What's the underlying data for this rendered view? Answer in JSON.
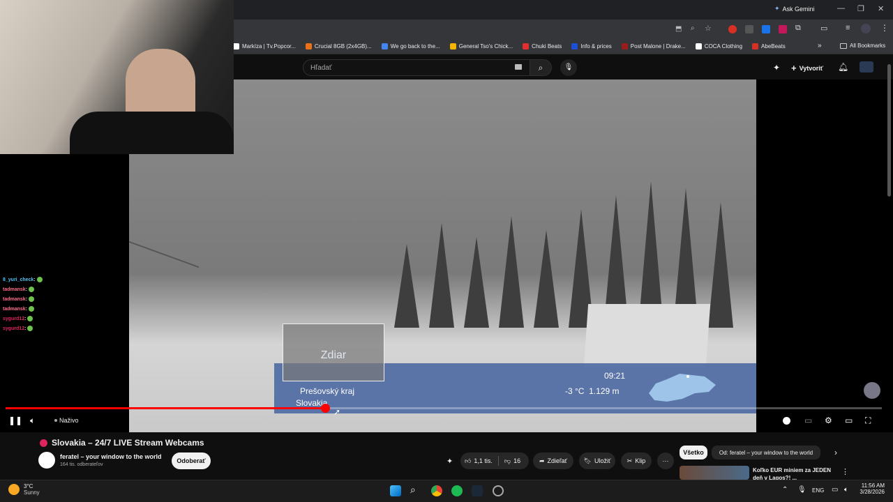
{
  "browser": {
    "ask_gemini": "Ask Gemini",
    "bookmarks": [
      {
        "label": "Markíza | Tv.Popcor...",
        "color": "#ffffff"
      },
      {
        "label": "Crucial 8GB (2x4GB)...",
        "color": "#e8711a"
      },
      {
        "label": "We go back to the...",
        "color": "#4285f4"
      },
      {
        "label": "General Tso's Chick...",
        "color": "#f4b400"
      },
      {
        "label": "Chuki Beats",
        "color": "#e02f2f"
      },
      {
        "label": "Info & prices",
        "color": "#1a4fd6"
      },
      {
        "label": "Post Malone | Drake...",
        "color": "#9b1c1c"
      },
      {
        "label": "COCA Clothing",
        "color": "#ffffff"
      },
      {
        "label": "AbeBeats",
        "color": "#d93025"
      }
    ],
    "all_bookmarks": "All Bookmarks",
    "more_chevron": "»"
  },
  "yt_header": {
    "search_placeholder": "Hľadať",
    "create_label": "Vytvoriť"
  },
  "overlay": {
    "cam_title": "Zdiar",
    "region": "Prešovský kraj",
    "country": "Slovakia",
    "time": "09:21",
    "weather": "-3 °C  1.129 m"
  },
  "chat": [
    {
      "user": "8_yuri_check",
      "color": "#4fc3f7"
    },
    {
      "user": "tadmansk",
      "color": "#ff6b8b"
    },
    {
      "user": "tadmansk",
      "color": "#ff6b8b"
    },
    {
      "user": "tadmansk",
      "color": "#ff6b8b"
    },
    {
      "user": "sygurd12",
      "color": "#e0245e"
    },
    {
      "user": "sygurd12",
      "color": "#e0245e"
    }
  ],
  "player": {
    "live_label": "Naživo",
    "progress_fraction": 0.365
  },
  "video_info": {
    "title": "Slovakia – 24/7 LIVE Stream Webcams",
    "channel_name": "feratel – your window to the world",
    "subscribers": "164 tis. odberateľov",
    "subscribe_label": "Odoberať",
    "likes": "1,1 tis.",
    "dislikes": "16",
    "share": "Zdieľať",
    "save": "Uložiť",
    "clip": "Klip",
    "chip_all": "Všetko",
    "chip_from": "Od: feratel – your window to the world",
    "rec_title": "Koľko EUR miniem za JEDEN",
    "rec_subtitle": "deň v Lagos?! ..."
  },
  "taskbar": {
    "weather_temp": "3°C",
    "weather_desc": "Sunny",
    "lang": "ENG",
    "time": "11:56 AM",
    "date": "3/28/2026"
  }
}
